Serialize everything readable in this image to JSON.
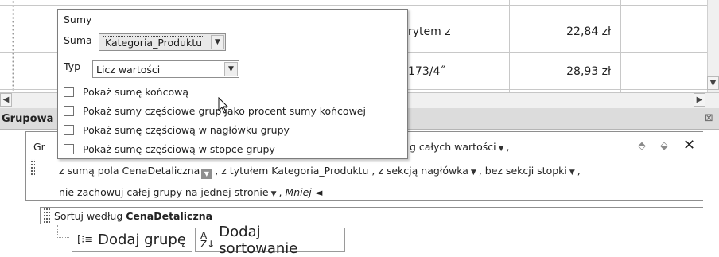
{
  "report_rows": [
    {
      "text": "rytem z",
      "price": "22,84 zł"
    },
    {
      "text": "173/4˝",
      "price": "28,93 zł"
    }
  ],
  "pane": {
    "title": "Grupowa",
    "close_glyph": "⊠"
  },
  "popup": {
    "title": "Sumy",
    "sum_label": "Suma",
    "sum_value": "Kategoria_Produktu",
    "type_label": "Typ",
    "type_value": "Licz wartości",
    "options": [
      {
        "label": "Pokaż sumę końcową",
        "checked": false
      },
      {
        "label": "Pokaż sumy częściowe grup jako procent sumy końcowej",
        "checked": false
      },
      {
        "label": "Pokaż sumę częściową w nagłówku grupy",
        "checked": false
      },
      {
        "label": "Pokaż sumę częściową w stopce grupy",
        "checked": false
      }
    ]
  },
  "group": {
    "line1_prefix": "Gr",
    "line1_suffix": "g całych wartości",
    "line2_sum": "z sumą pola CenaDetaliczna",
    "line2_title": ", z tytułem Kategoria_Produktu ,",
    "line2_header": "z sekcją nagłówka",
    "line2_footer": "bez sekcji stopki",
    "line3_keep": "nie zachowuj całej grupy na jednej stronie",
    "line3_less": "Mniej ◄",
    "sort_prefix": "Sortuj według",
    "sort_field": "CenaDetaliczna"
  },
  "buttons": {
    "add_group": "Dodaj grupę",
    "add_sort": "Dodaj sortowanie"
  }
}
